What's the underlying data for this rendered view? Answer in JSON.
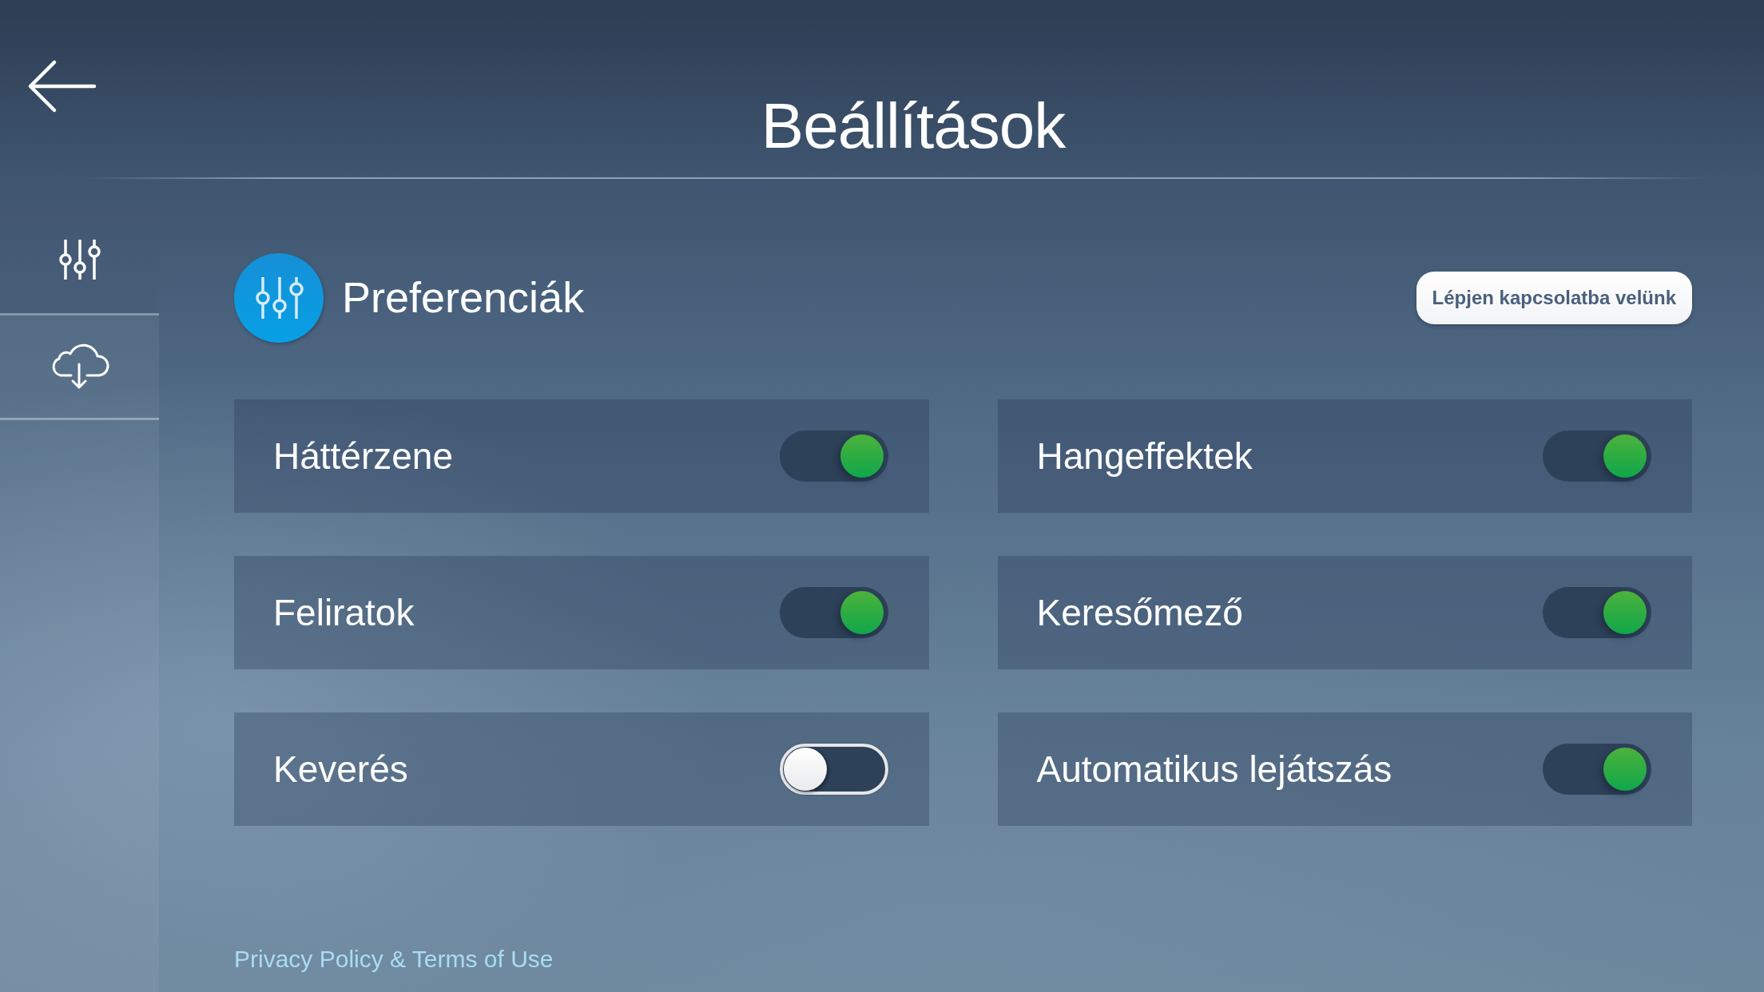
{
  "header": {
    "title": "Beállítások"
  },
  "sidebar": {
    "items": [
      {
        "kind": "sliders",
        "selected": true
      },
      {
        "kind": "cloud-download",
        "selected": false
      }
    ]
  },
  "section": {
    "title": "Preferenciák",
    "contact_button": "Lépjen kapcsolatba velünk"
  },
  "settings": [
    {
      "label": "Háttérzene",
      "on": true
    },
    {
      "label": "Hangeffektek",
      "on": true
    },
    {
      "label": "Feliratok",
      "on": true
    },
    {
      "label": "Keresőmező",
      "on": true
    },
    {
      "label": "Keverés",
      "on": false
    },
    {
      "label": "Automatikus lejátszás",
      "on": true
    }
  ],
  "footer": {
    "link": "Privacy Policy & Terms of Use"
  }
}
